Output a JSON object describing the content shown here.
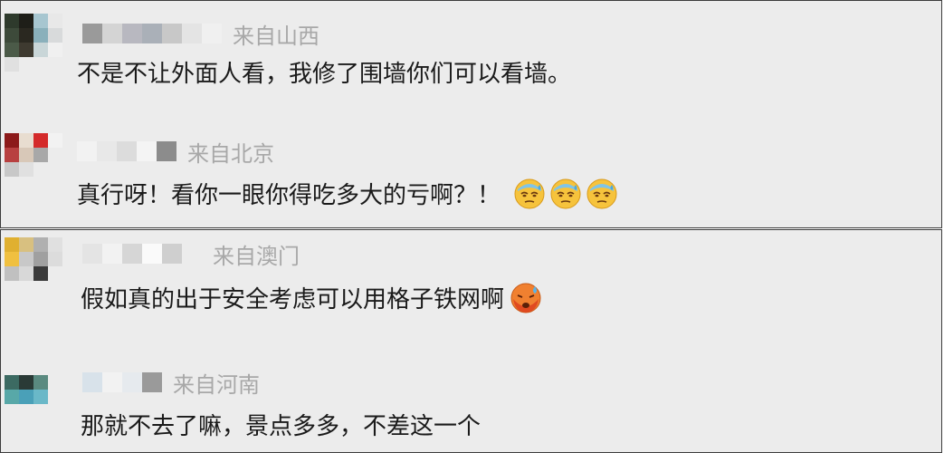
{
  "comments": [
    {
      "location": "来自山西",
      "text": "不是不让外面人看，我修了围墙你们可以看墙。",
      "emojis": [],
      "avatar_colors": [
        "#2e3a2c",
        "#1e1e18",
        "#a7c6d0",
        "#e8e8e8",
        "#3d4a3a",
        "#2a2820",
        "#8ab0bb",
        "#d8dadb",
        "#4b5a48",
        "#3e3a30",
        "#c9d6d8",
        "#f0f0f0",
        "#e0e0e0",
        "#ececec",
        "#ececec",
        "#ececec"
      ],
      "name_mosaic_colors": [
        "#9a9a9a",
        "#d4d4d4",
        "#b8b8c0",
        "#aab0b8",
        "#c8c8c8",
        "#e4e4e4",
        "#f0f0f0"
      ]
    },
    {
      "location": "来自北京",
      "text": "真行呀！看你一眼你得吃多大的亏啊？！",
      "emojis": [
        "cold-sweat-face-icon",
        "cold-sweat-face-icon",
        "cold-sweat-face-icon"
      ],
      "avatar_colors": [
        "#8c1a1a",
        "#e8ddd0",
        "#d42a2a",
        "#f2f2f2",
        "#b84040",
        "#d8c8b8",
        "#a8a8a8",
        "#ececec",
        "#c8c8c8",
        "#e0e0e0",
        "#ececec",
        "#ececec",
        "#ececec",
        "#ececec",
        "#ececec",
        "#ececec"
      ],
      "name_mosaic_colors": [
        "#f2f2f2",
        "#e8e8e8",
        "#dcdcdc",
        "#f4f4f4",
        "#8c8c8c"
      ]
    },
    {
      "location": "来自澳门",
      "text": "假如真的出于安全考虑可以用格子铁网啊",
      "emojis": [
        "weary-face-icon"
      ],
      "avatar_colors": [
        "#e0b030",
        "#d8c080",
        "#b0b0b0",
        "#e0e0e0",
        "#f0c040",
        "#c8c8c8",
        "#a0a0a0",
        "#dcdcdc",
        "#c0c0c0",
        "#d8d8d8",
        "#3a3a3a",
        "#ececec",
        "#ececec",
        "#ececec",
        "#ececec",
        "#ececec"
      ],
      "name_mosaic_colors": [
        "#e4e4e4",
        "#f2f2f2",
        "#d6d6d6",
        "#fafafa",
        "#cfcfcf",
        "#ececec"
      ]
    },
    {
      "location": "来自河南",
      "text": "那就不去了嘛，景点多多，不差这一个",
      "emojis": [],
      "avatar_colors": [
        "#ececec",
        "#ececec",
        "#ececec",
        "#ececec",
        "#3c6a62",
        "#2a3a36",
        "#5a8a80",
        "#ececec",
        "#58a8a8",
        "#4aa0b8",
        "#6ab8c8",
        "#ececec",
        "#ececec",
        "#ececec",
        "#ececec",
        "#ececec"
      ],
      "name_mosaic_colors": [
        "#d8e2ea",
        "#f2f2f2",
        "#e6eaee",
        "#9a9a9a"
      ]
    }
  ]
}
